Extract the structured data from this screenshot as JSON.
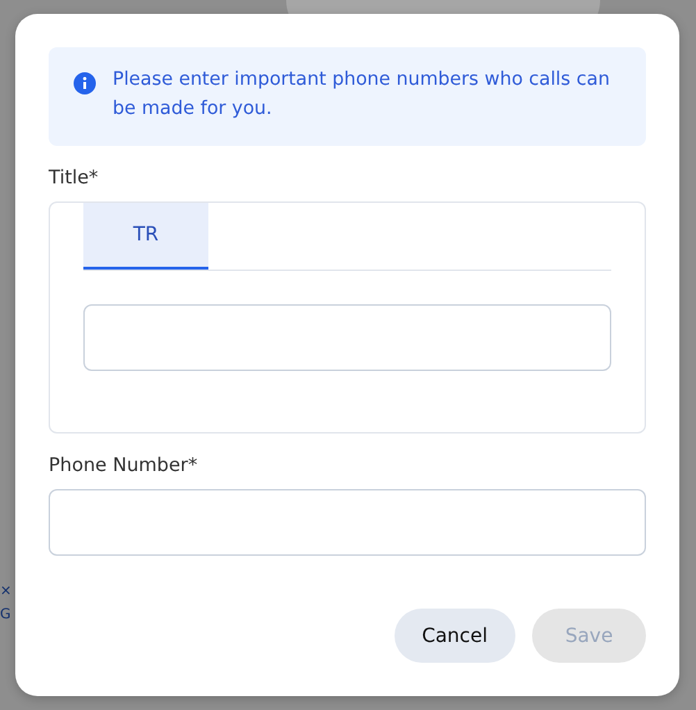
{
  "background": {
    "fragments": [
      {
        "text": "×"
      },
      {
        "text": "G"
      }
    ]
  },
  "dialog": {
    "info": "Please enter important phone numbers who calls can be made for you.",
    "title_label": "Title*",
    "tabs": [
      {
        "label": "TR",
        "selected": true
      }
    ],
    "phone_label": "Phone Number*",
    "buttons": [
      {
        "label": "Cancel",
        "disabled": false
      },
      {
        "label": "Save",
        "disabled": true
      }
    ]
  }
}
